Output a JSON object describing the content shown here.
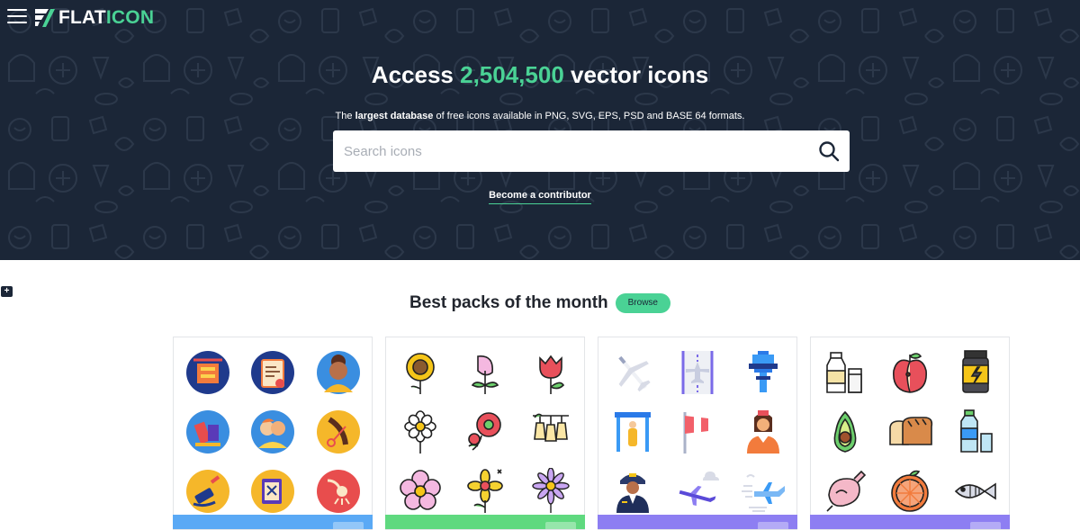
{
  "header": {
    "logo_prefix": "FLAT",
    "logo_suffix": "ICON"
  },
  "hero": {
    "title_prefix": "Access ",
    "icon_count": "2,504,500",
    "title_suffix": " vector icons",
    "subtitle_pre": "The ",
    "subtitle_bold": "largest database",
    "subtitle_post": " of free icons available in PNG, SVG, EPS, PSD and BASE 64 formats.",
    "search_placeholder": "Search icons",
    "contributor_link": "Become a contributor"
  },
  "side_button": {
    "label": "+"
  },
  "best_packs": {
    "title": "Best packs of the month",
    "browse_label": "Browse",
    "packs": [
      {
        "theme": "circle-illustrations",
        "bar_color": "#5aa9f5",
        "icons": [
          "playground-circle-icon",
          "certificate-circle-icon",
          "woman-avatar-circle-icon",
          "toys-circle-icon",
          "family-circle-icon",
          "hairdresser-scissors-circle-icon",
          "paint-roller-circle-icon",
          "crafts-scissors-circle-icon",
          "shower-circle-icon"
        ]
      },
      {
        "theme": "flowers",
        "bar_color": "#5fd97f",
        "icons": [
          "sunflower-icon",
          "calla-lily-icon",
          "tulip-icon",
          "daisy-icon",
          "poppy-icon",
          "bell-flowers-icon",
          "cherry-blossom-icon",
          "yellow-flower-icon",
          "purple-aster-icon"
        ]
      },
      {
        "theme": "airport",
        "bar_color": "#8d7ef2",
        "icons": [
          "airplane-icon",
          "runway-icon",
          "control-tower-icon",
          "security-gate-icon",
          "windsock-icon",
          "flight-attendant-icon",
          "pilot-icon",
          "airplane-clouds-icon",
          "airplane-wind-icon"
        ]
      },
      {
        "theme": "food",
        "bar_color": "#8d7ef2",
        "icons": [
          "milk-icon",
          "apple-icon",
          "protein-jar-icon",
          "avocado-icon",
          "bread-icon",
          "water-bottle-icon",
          "chicken-icon",
          "grapefruit-icon",
          "fish-icon"
        ]
      }
    ]
  }
}
